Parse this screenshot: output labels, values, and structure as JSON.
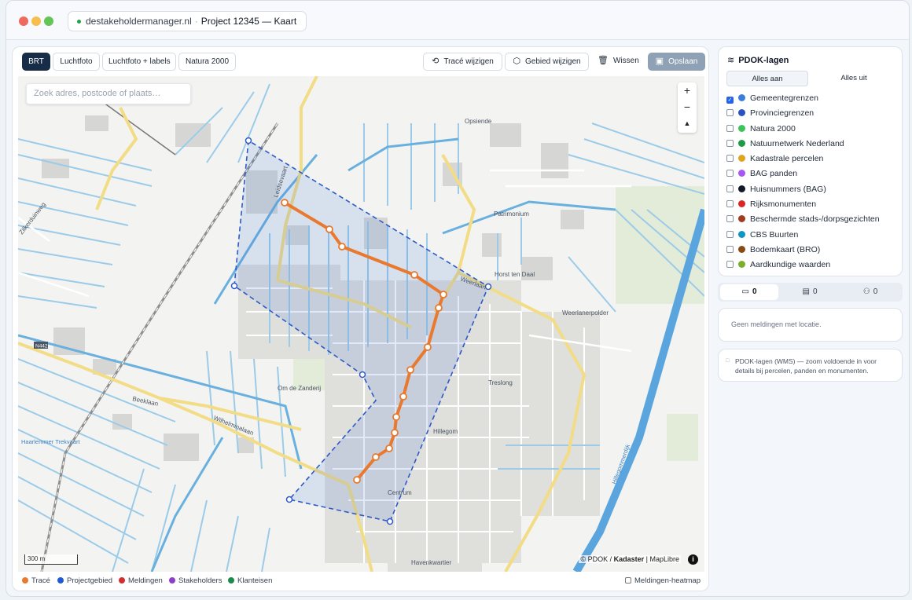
{
  "window": {
    "url_domain": "destakeholdermanager.nl",
    "separator": "·",
    "page_title": "Project 12345 — Kaart"
  },
  "toolbar": {
    "basemaps": [
      "BRT",
      "Luchtfoto",
      "Luchtfoto + labels",
      "Natura 2000"
    ],
    "active_basemap": "BRT",
    "edit_route": "Tracé wijzigen",
    "edit_area": "Gebied wijzigen",
    "clear": "Wissen",
    "save": "Opslaan"
  },
  "map": {
    "search_placeholder": "Zoek adres, postcode of plaats…",
    "zoom_in": "+",
    "zoom_out": "−",
    "compass": "▲",
    "scale": "300 m",
    "attribution": {
      "prefix": "© PDOK / ",
      "kadaster": "Kadaster",
      "sep": " | ",
      "maplibre": "MapLibre"
    },
    "info": "i",
    "labels": {
      "Opsiende": "Opsiende",
      "Patrimonium": "Patrimonium",
      "Horst ten Daal": "Horst ten Daal",
      "Weerlanerpolder": "Weerlanerpolder",
      "Weerlaan": "Weerlaan",
      "Om de Zanderij": "Om de Zanderij",
      "Treslong": "Treslong",
      "Hillegom": "Hillegom",
      "Centrum": "Centrum",
      "Beeklaan": "Beeklaan",
      "Wilhelminalaan": "Wilhelminalaan",
      "Haarlemmer Trekvaart": "Haarlemmer Trekvaart",
      "N442": "N442",
      "Havenkwartier": "Havenkwartier",
      "Zilkerduinweg": "Zilkerduinweg",
      "Leidsevaart": "Leidsevaart",
      "Hillegommerdijk": "Hillegommerdijk"
    },
    "colors": {
      "route": "#e8792e",
      "area_stroke": "#2d5ac8",
      "area_fill": "#3b6fd8",
      "water": "#8ec3e6",
      "road": "#f2dc86"
    }
  },
  "legend": {
    "items": [
      {
        "label": "Tracé",
        "color": "#e8792e"
      },
      {
        "label": "Projectgebied",
        "color": "#2459d6"
      },
      {
        "label": "Meldingen",
        "color": "#d42d2d"
      },
      {
        "label": "Stakeholders",
        "color": "#8b3fd1"
      },
      {
        "label": "Klanteisen",
        "color": "#1c8a4e"
      }
    ],
    "heatmap_label": "Meldingen-heatmap"
  },
  "layers": {
    "title": "PDOK-lagen",
    "all_on": "Alles aan",
    "all_off": "Alles uit",
    "items": [
      {
        "label": "Gemeentegrenzen",
        "color": "#3b7ddd",
        "checked": true
      },
      {
        "label": "Provinciegrenzen",
        "color": "#2952c4",
        "checked": false
      },
      {
        "label": "Natura 2000",
        "color": "#3ac45b",
        "checked": false
      },
      {
        "label": "Natuurnetwerk Nederland",
        "color": "#1e9948",
        "checked": false
      },
      {
        "label": "Kadastrale percelen",
        "color": "#e0a420",
        "checked": false
      },
      {
        "label": "BAG panden",
        "color": "#a855f7",
        "checked": false
      },
      {
        "label": "Huisnummers (BAG)",
        "color": "#111827",
        "checked": false
      },
      {
        "label": "Rijksmonumenten",
        "color": "#dc2626",
        "checked": false
      },
      {
        "label": "Beschermde stads-/dorpsgezichten",
        "color": "#a23a1e",
        "checked": false
      },
      {
        "label": "CBS Buurten",
        "color": "#0e95c4",
        "checked": false
      },
      {
        "label": "Bodemkaart (BRO)",
        "color": "#8a4a14",
        "checked": false
      },
      {
        "label": "Aardkundige waarden",
        "color": "#7cae2a",
        "checked": false
      }
    ]
  },
  "tabs": [
    {
      "icon": "message-icon",
      "count": "0"
    },
    {
      "icon": "clipboard-icon",
      "count": "0"
    },
    {
      "icon": "users-icon",
      "count": "0"
    }
  ],
  "messages": {
    "empty": "Geen meldingen met locatie."
  },
  "note": {
    "text": "PDOK-lagen (WMS) — zoom voldoende in voor details bij percelen, panden en monumenten."
  }
}
